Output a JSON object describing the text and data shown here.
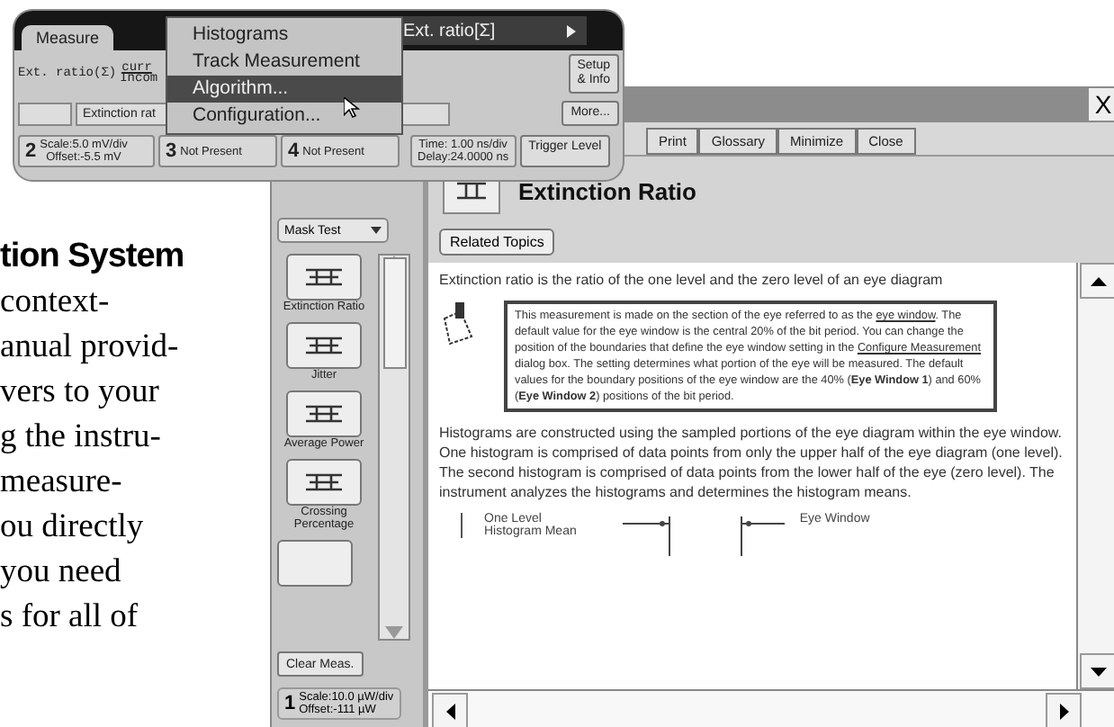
{
  "printed_text": {
    "heading": "tion System",
    "lines": [
      "context-",
      "anual provid-",
      "vers to your",
      "g the instru-",
      "measure-",
      "ou directly",
      "you need",
      "s for all of"
    ]
  },
  "scope_panel": {
    "tab": "Measure",
    "measurement_label": "Ext. ratio(Σ)",
    "column_header": "curr",
    "column_value": "Incom",
    "menu_parent": "Ext. ratio[Σ]",
    "setup_button": [
      "Setup",
      "& Info"
    ],
    "measurement_field": "Extinction rat",
    "more_button": "More...",
    "channels": [
      {
        "number": "2",
        "lines": [
          "Scale:5.0 mV/div",
          "Offset:-5.5 mV"
        ]
      },
      {
        "number": "3",
        "lines": [
          "Not Present"
        ]
      },
      {
        "number": "4",
        "lines": [
          "Not Present"
        ]
      }
    ],
    "timebase": [
      "Time: 1.00 ns/div",
      "Delay:24.0000 ns"
    ],
    "trigger_button": "Trigger Level"
  },
  "menu": {
    "items": [
      {
        "label": "Histograms",
        "selected": false
      },
      {
        "label": "Track Measurement",
        "selected": false
      },
      {
        "label": "Algorithm...",
        "selected": true
      },
      {
        "label": "Configuration...",
        "selected": false
      }
    ]
  },
  "help_window": {
    "close": "X",
    "toolbar": [
      "Print",
      "Glossary",
      "Minimize",
      "Close"
    ],
    "sidebar": {
      "dropdown": "Mask Test",
      "tools": [
        {
          "label": "Extinction Ratio"
        },
        {
          "label": "Jitter"
        },
        {
          "label": "Average Power"
        },
        {
          "label": "Crossing Percentage"
        }
      ],
      "clear_button": "Clear Meas.",
      "readout": {
        "number": "1",
        "lines": [
          "Scale:10.0 µW/div",
          "Offset:-111 µW"
        ]
      }
    },
    "topic": {
      "title": "Extinction Ratio",
      "related_button": "Related Topics",
      "intro": "Extinction ratio is the ratio of the one level and the zero level of an eye diagram",
      "note": [
        {
          "kind": "text",
          "text": "This measurement is made on the section of the eye referred to as the "
        },
        {
          "kind": "link",
          "text": "eye window"
        },
        {
          "kind": "text",
          "text": ". The default value for the eye window is the central 20% of the bit period. You can change the position of the boundaries that define the eye window setting in the "
        },
        {
          "kind": "link",
          "text": "Configure Measurement"
        },
        {
          "kind": "text",
          "text": " dialog box. The setting determines what portion of the eye will be measured. The default values for the boundary positions of the eye window are the 40% (**Eye Window 1**) and 60% (**Eye Window 2**) positions of the bit period."
        }
      ],
      "body": "Histograms are constructed using the sampled portions of the eye diagram within the eye window. One histogram is comprised of data points from only the upper half of the eye diagram (one level). The second histogram is comprised of data points from the lower half of the eye (zero level). The instrument analyzes the histograms and determines the histogram means.",
      "diagram_labels": [
        "One Level",
        "Histogram Mean",
        "Eye Window"
      ]
    }
  }
}
